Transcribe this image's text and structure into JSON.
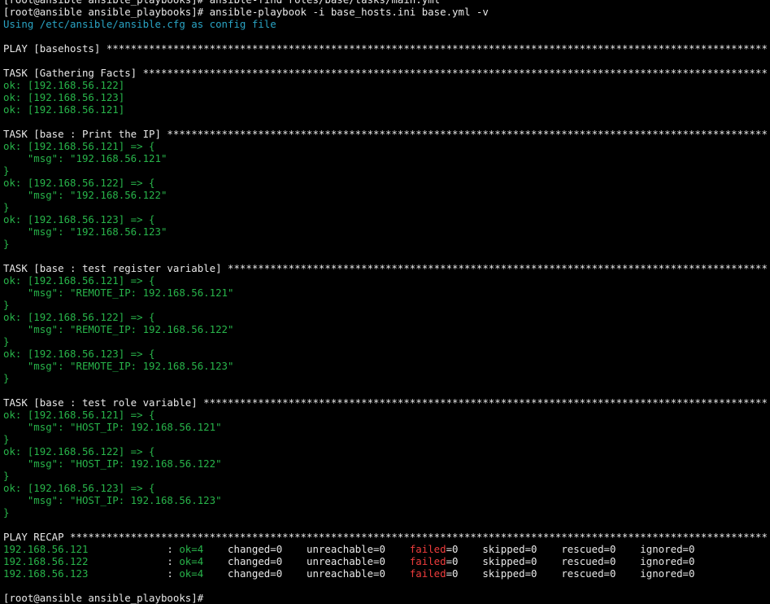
{
  "colors": {
    "background": "#000000",
    "default_text": "#e8e8e8",
    "ok_green": "#28b44a",
    "info_cyan": "#2aa4c4",
    "failed_red": "#ee3c3c"
  },
  "lines": [
    {
      "segments": [
        {
          "t": "[root@ansible ansible_playbooks]# ansible-find roles/base/tasks/main.yml",
          "c": "w"
        }
      ]
    },
    {
      "segments": [
        {
          "t": "[root@ansible ansible_playbooks]# ansible-playbook -i base_hosts.ini base.yml -v",
          "c": "w"
        }
      ]
    },
    {
      "segments": [
        {
          "t": "Using /etc/ansible/ansible.cfg as config file",
          "c": "c"
        }
      ]
    },
    {
      "segments": []
    },
    {
      "segments": [
        {
          "t": "PLAY [basehosts] *************************************************************************************************************",
          "c": "w"
        }
      ]
    },
    {
      "segments": []
    },
    {
      "segments": [
        {
          "t": "TASK [Gathering Facts] *******************************************************************************************************",
          "c": "w"
        }
      ]
    },
    {
      "segments": [
        {
          "t": "ok: [192.168.56.122]",
          "c": "g"
        }
      ]
    },
    {
      "segments": [
        {
          "t": "ok: [192.168.56.123]",
          "c": "g"
        }
      ]
    },
    {
      "segments": [
        {
          "t": "ok: [192.168.56.121]",
          "c": "g"
        }
      ]
    },
    {
      "segments": []
    },
    {
      "segments": [
        {
          "t": "TASK [base : Print the IP] ***************************************************************************************************",
          "c": "w"
        }
      ]
    },
    {
      "segments": [
        {
          "t": "ok: [192.168.56.121] => {",
          "c": "g"
        }
      ]
    },
    {
      "segments": [
        {
          "t": "    \"msg\": \"192.168.56.121\"",
          "c": "g"
        }
      ]
    },
    {
      "segments": [
        {
          "t": "}",
          "c": "g"
        }
      ]
    },
    {
      "segments": [
        {
          "t": "ok: [192.168.56.122] => {",
          "c": "g"
        }
      ]
    },
    {
      "segments": [
        {
          "t": "    \"msg\": \"192.168.56.122\"",
          "c": "g"
        }
      ]
    },
    {
      "segments": [
        {
          "t": "}",
          "c": "g"
        }
      ]
    },
    {
      "segments": [
        {
          "t": "ok: [192.168.56.123] => {",
          "c": "g"
        }
      ]
    },
    {
      "segments": [
        {
          "t": "    \"msg\": \"192.168.56.123\"",
          "c": "g"
        }
      ]
    },
    {
      "segments": [
        {
          "t": "}",
          "c": "g"
        }
      ]
    },
    {
      "segments": []
    },
    {
      "segments": [
        {
          "t": "TASK [base : test register variable] *****************************************************************************************",
          "c": "w"
        }
      ]
    },
    {
      "segments": [
        {
          "t": "ok: [192.168.56.121] => {",
          "c": "g"
        }
      ]
    },
    {
      "segments": [
        {
          "t": "    \"msg\": \"REMOTE_IP: 192.168.56.121\"",
          "c": "g"
        }
      ]
    },
    {
      "segments": [
        {
          "t": "}",
          "c": "g"
        }
      ]
    },
    {
      "segments": [
        {
          "t": "ok: [192.168.56.122] => {",
          "c": "g"
        }
      ]
    },
    {
      "segments": [
        {
          "t": "    \"msg\": \"REMOTE_IP: 192.168.56.122\"",
          "c": "g"
        }
      ]
    },
    {
      "segments": [
        {
          "t": "}",
          "c": "g"
        }
      ]
    },
    {
      "segments": [
        {
          "t": "ok: [192.168.56.123] => {",
          "c": "g"
        }
      ]
    },
    {
      "segments": [
        {
          "t": "    \"msg\": \"REMOTE_IP: 192.168.56.123\"",
          "c": "g"
        }
      ]
    },
    {
      "segments": [
        {
          "t": "}",
          "c": "g"
        }
      ]
    },
    {
      "segments": []
    },
    {
      "segments": [
        {
          "t": "TASK [base : test role variable] *********************************************************************************************",
          "c": "w"
        }
      ]
    },
    {
      "segments": [
        {
          "t": "ok: [192.168.56.121] => {",
          "c": "g"
        }
      ]
    },
    {
      "segments": [
        {
          "t": "    \"msg\": \"HOST_IP: 192.168.56.121\"",
          "c": "g"
        }
      ]
    },
    {
      "segments": [
        {
          "t": "}",
          "c": "g"
        }
      ]
    },
    {
      "segments": [
        {
          "t": "ok: [192.168.56.122] => {",
          "c": "g"
        }
      ]
    },
    {
      "segments": [
        {
          "t": "    \"msg\": \"HOST_IP: 192.168.56.122\"",
          "c": "g"
        }
      ]
    },
    {
      "segments": [
        {
          "t": "}",
          "c": "g"
        }
      ]
    },
    {
      "segments": [
        {
          "t": "ok: [192.168.56.123] => {",
          "c": "g"
        }
      ]
    },
    {
      "segments": [
        {
          "t": "    \"msg\": \"HOST_IP: 192.168.56.123\"",
          "c": "g"
        }
      ]
    },
    {
      "segments": [
        {
          "t": "}",
          "c": "g"
        }
      ]
    },
    {
      "segments": []
    },
    {
      "segments": [
        {
          "t": "PLAY RECAP *******************************************************************************************************************",
          "c": "w"
        }
      ]
    },
    {
      "segments": [
        {
          "t": "192.168.56.121",
          "c": "g"
        },
        {
          "t": "             : ",
          "c": "w"
        },
        {
          "t": "ok=4",
          "c": "g"
        },
        {
          "t": "    changed=0    unreachable=0    ",
          "c": "w"
        },
        {
          "t": "failed",
          "c": "r"
        },
        {
          "t": "=0    skipped=0    rescued=0    ignored=0",
          "c": "w"
        }
      ]
    },
    {
      "segments": [
        {
          "t": "192.168.56.122",
          "c": "g"
        },
        {
          "t": "             : ",
          "c": "w"
        },
        {
          "t": "ok=4",
          "c": "g"
        },
        {
          "t": "    changed=0    unreachable=0    ",
          "c": "w"
        },
        {
          "t": "failed",
          "c": "r"
        },
        {
          "t": "=0    skipped=0    rescued=0    ignored=0",
          "c": "w"
        }
      ]
    },
    {
      "segments": [
        {
          "t": "192.168.56.123",
          "c": "g"
        },
        {
          "t": "             : ",
          "c": "w"
        },
        {
          "t": "ok=4",
          "c": "g"
        },
        {
          "t": "    changed=0    unreachable=0    ",
          "c": "w"
        },
        {
          "t": "failed",
          "c": "r"
        },
        {
          "t": "=0    skipped=0    rescued=0    ignored=0",
          "c": "w"
        }
      ]
    },
    {
      "segments": []
    },
    {
      "segments": [
        {
          "t": "[root@ansible ansible_playbooks]# ",
          "c": "w"
        }
      ]
    }
  ]
}
